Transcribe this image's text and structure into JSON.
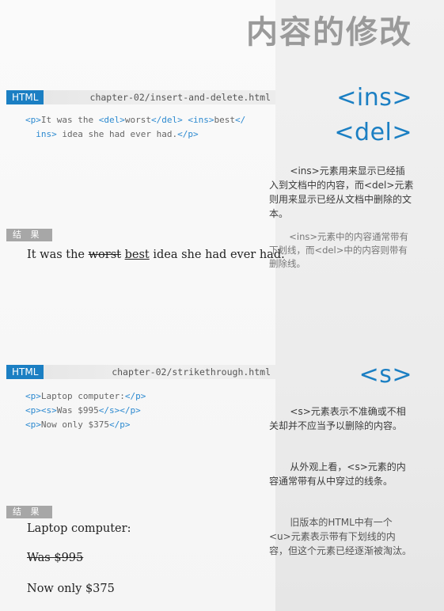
{
  "page": {
    "title": "内容的修改"
  },
  "section1": {
    "tag": "HTML",
    "filename": "chapter-02/insert-and-delete.html",
    "code_lines": [
      [
        {
          "c": "t",
          "v": "<p>"
        },
        {
          "c": "",
          "v": "It was the "
        },
        {
          "c": "t",
          "v": "<del>"
        },
        {
          "c": "",
          "v": "worst"
        },
        {
          "c": "t",
          "v": "</del>"
        },
        {
          "c": "",
          "v": " "
        },
        {
          "c": "t",
          "v": "<ins>"
        },
        {
          "c": "",
          "v": "best"
        },
        {
          "c": "t",
          "v": "</"
        }
      ],
      [
        {
          "c": "t",
          "v": "  ins>"
        },
        {
          "c": "",
          "v": " idea she had ever had."
        },
        {
          "c": "t",
          "v": "</p>"
        }
      ]
    ],
    "result_label": "结 果",
    "result": {
      "before": "It was the ",
      "deleted": "worst",
      "between": " ",
      "inserted": "best",
      "after": " idea she had ever had."
    },
    "big_tags": [
      "<ins>",
      "<del>"
    ],
    "para1": "<ins>元素用来显示已经插入到文档中的内容，而<del>元素则用来显示已经从文档中删除的文本。",
    "para2": "<ins>元素中的内容通常带有下划线，而<del>中的内容则带有删除线。"
  },
  "section2": {
    "tag": "HTML",
    "filename": "chapter-02/strikethrough.html",
    "code_lines": [
      [
        {
          "c": "t",
          "v": "<p>"
        },
        {
          "c": "",
          "v": "Laptop computer:"
        },
        {
          "c": "t",
          "v": "</p>"
        }
      ],
      [
        {
          "c": "t",
          "v": "<p><s>"
        },
        {
          "c": "",
          "v": "Was $995"
        },
        {
          "c": "t",
          "v": "</s></p>"
        }
      ],
      [
        {
          "c": "t",
          "v": "<p>"
        },
        {
          "c": "",
          "v": "Now only $375"
        },
        {
          "c": "t",
          "v": "</p>"
        }
      ]
    ],
    "result_label": "结 果",
    "result": {
      "line1": "Laptop computer:",
      "line2": "Was $995",
      "line3": "Now only $375"
    },
    "big_tag": "<s>",
    "para1": "<s>元素表示不准确或不相关却并不应当予以删除的内容。",
    "para2": "从外观上看，<s>元素的内容通常带有从中穿过的线条。",
    "para3": "旧版本的HTML中有一个<u>元素表示带有下划线的内容，但这个元素已经逐渐被淘汰。"
  }
}
